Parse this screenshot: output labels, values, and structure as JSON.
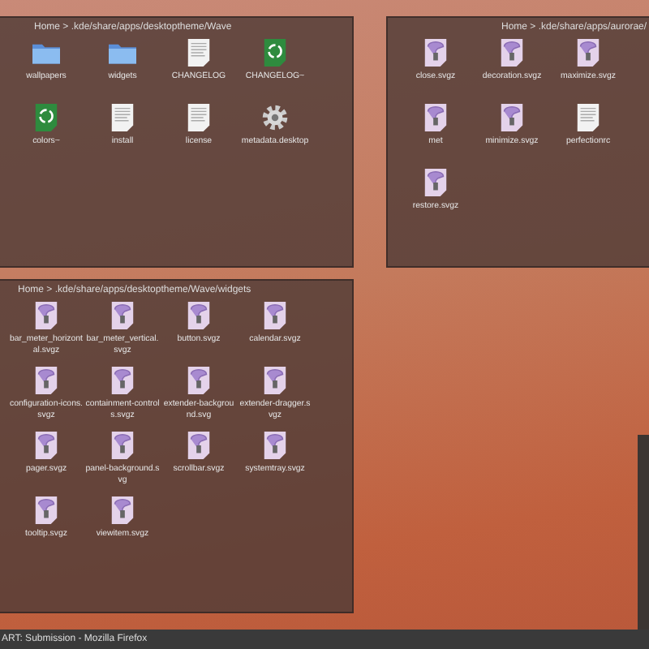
{
  "panels": [
    {
      "breadcrumb": "Home > .kde/share/apps/desktoptheme/Wave",
      "items": [
        {
          "label": "wallpapers",
          "kind": "folder"
        },
        {
          "label": "widgets",
          "kind": "folder"
        },
        {
          "label": "CHANGELOG",
          "kind": "text"
        },
        {
          "label": "CHANGELOG~",
          "kind": "backup"
        },
        {
          "label": "colors~",
          "kind": "backup"
        },
        {
          "label": "install",
          "kind": "text"
        },
        {
          "label": "license",
          "kind": "text"
        },
        {
          "label": "metadata.desktop",
          "kind": "settings"
        }
      ]
    },
    {
      "breadcrumb": "Home > .kde/share/apps/aurorae/",
      "items": [
        {
          "label": "close.svgz",
          "kind": "svg"
        },
        {
          "label": "decoration.svgz",
          "kind": "svg"
        },
        {
          "label": "maximize.svgz",
          "kind": "svg"
        },
        {
          "label": "met",
          "kind": "svg"
        },
        {
          "label": "minimize.svgz",
          "kind": "svg"
        },
        {
          "label": "perfectionrc",
          "kind": "text"
        },
        {
          "label": "restore.svgz",
          "kind": "svg"
        }
      ]
    },
    {
      "breadcrumb": "Home > .kde/share/apps/desktoptheme/Wave/widgets",
      "items": [
        {
          "label": "bar_meter_horizontal.svgz",
          "kind": "svg"
        },
        {
          "label": "bar_meter_vertical.svgz",
          "kind": "svg"
        },
        {
          "label": "button.svgz",
          "kind": "svg"
        },
        {
          "label": "calendar.svgz",
          "kind": "svg"
        },
        {
          "label": "configuration-icons.svgz",
          "kind": "svg"
        },
        {
          "label": "containment-controls.svgz",
          "kind": "svg"
        },
        {
          "label": "extender-background.svg",
          "kind": "svg"
        },
        {
          "label": "extender-dragger.svgz",
          "kind": "svg"
        },
        {
          "label": "pager.svgz",
          "kind": "svg"
        },
        {
          "label": "panel-background.svg",
          "kind": "svg"
        },
        {
          "label": "scrollbar.svgz",
          "kind": "svg"
        },
        {
          "label": "systemtray.svgz",
          "kind": "svg"
        },
        {
          "label": "tooltip.svgz",
          "kind": "svg"
        },
        {
          "label": "viewitem.svgz",
          "kind": "svg"
        }
      ]
    }
  ],
  "taskbar": {
    "task": "ART: Submission - Mozilla Firefox"
  }
}
